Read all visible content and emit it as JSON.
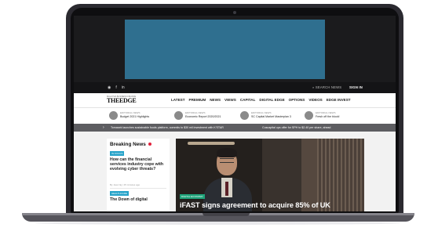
{
  "topbar": {
    "social_icons": [
      "instagram-icon",
      "facebook-icon",
      "linkedin-icon"
    ],
    "social_glyphs": [
      "◉",
      "f",
      "in"
    ],
    "search": "SEARCH NEWS",
    "signin": "SIGN IN"
  },
  "logo": {
    "tagline": "MALAYSIA BUSINESS FINANCE",
    "text": "THEEDGE"
  },
  "nav": {
    "items": [
      "LATEST",
      "PREMIUM",
      "NEWS",
      "VIEWS",
      "CAPITAL",
      "DIGITAL EDGE",
      "OPTIONS",
      "VIDEOS",
      "EDGE INVEST"
    ]
  },
  "editorial": {
    "items": [
      {
        "kicker": "EDITORIAL NEWS",
        "title": "Budget 2021 Highlights"
      },
      {
        "kicker": "EDITORIAL NEWS",
        "title": "Economic Report 2020/2021"
      },
      {
        "kicker": "EDITORIAL NEWS",
        "title": "SC Capital Market Masterplan 3"
      },
      {
        "kicker": "EDITORIAL NEWS",
        "title": "Fresh off the block!"
      }
    ]
  },
  "ticker": {
    "items": [
      "Tomasek launches sustainable foods platform, commits to $30 mil investment with K'STAR",
      "Cuscapital ups offer for SPH to $2.40 per share, ahead"
    ]
  },
  "breaking": {
    "title": "Breaking News",
    "stories": [
      {
        "badge": "IN FOCUS",
        "title": "How can the financial services industry cope with evolving cyber threats?",
        "meta": "By Jess Ng  |  15 minutes ago"
      },
      {
        "badge": "HEALTHCARE",
        "title": "The Down of digital",
        "meta": ""
      }
    ]
  },
  "hero": {
    "badge": "DIGITAL ECONOMY",
    "headline": "iFAST signs agreement to acquire 85% of UK"
  },
  "colors": {
    "ad_block": "#2f6f8f",
    "badge_blue": "#26a3c9",
    "badge_green": "#1fa37a",
    "breaking_dot": "#e2223c",
    "ticker": "#5d5d61"
  }
}
